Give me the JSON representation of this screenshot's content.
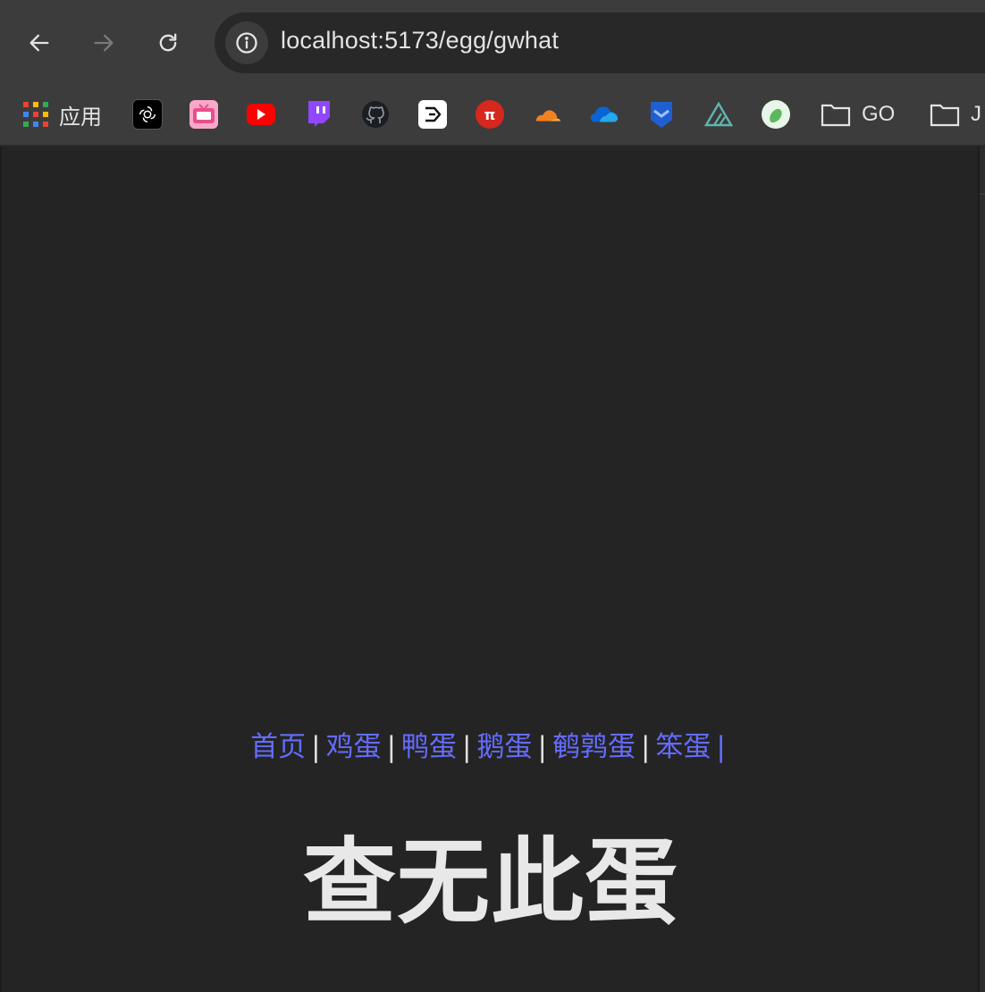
{
  "toolbar": {
    "url": "localhost:5173/egg/gwhat",
    "back_icon": "arrow-left-icon",
    "forward_icon": "arrow-right-icon",
    "reload_icon": "reload-icon",
    "site_info_icon": "info-circle-icon"
  },
  "bookmarks": {
    "apps_label": "应用",
    "folder_go": "GO",
    "folder_j": "J",
    "items": [
      {
        "icon": "openai-icon"
      },
      {
        "icon": "bilibili-tv-icon"
      },
      {
        "icon": "youtube-icon"
      },
      {
        "icon": "twitch-icon"
      },
      {
        "icon": "github-icon"
      },
      {
        "icon": "arrow-box-icon"
      },
      {
        "icon": "pi-icon"
      },
      {
        "icon": "cloudflare-icon"
      },
      {
        "icon": "onedrive-icon"
      },
      {
        "icon": "shield-bookmark-icon"
      },
      {
        "icon": "triangle-logo-icon"
      },
      {
        "icon": "green-blob-icon"
      }
    ]
  },
  "page": {
    "links": [
      "首页",
      "鸡蛋",
      "鸭蛋",
      "鹅蛋",
      "鹌鹑蛋",
      "笨蛋"
    ],
    "separator": "|",
    "title": "查无此蛋"
  },
  "colors": {
    "link": "#646cff",
    "background": "#242424",
    "text": "#e8e8e8"
  }
}
